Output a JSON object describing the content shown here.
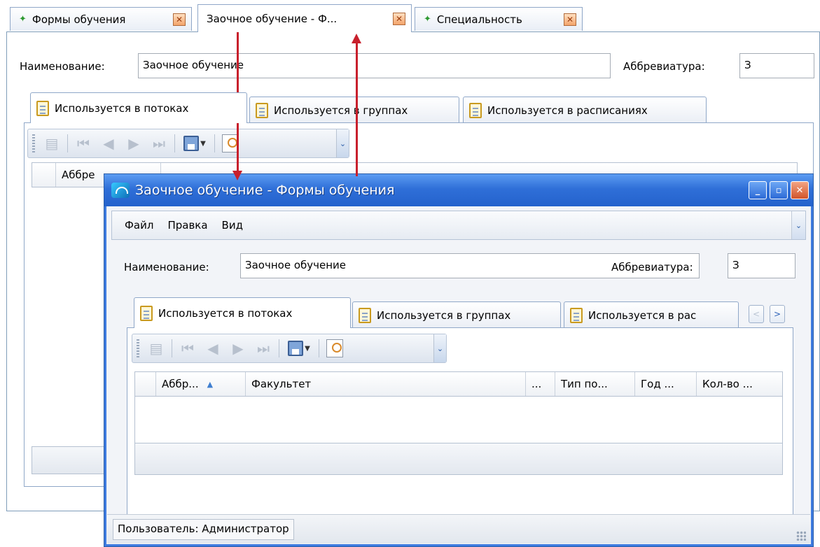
{
  "mdi_tabs": [
    {
      "label": "Формы обучения",
      "icon": "green-star-icon",
      "active": false
    },
    {
      "label": "Заочное обучение - Ф...",
      "icon": "",
      "active": true
    },
    {
      "label": "Специальность",
      "icon": "green-star-icon",
      "active": false
    }
  ],
  "background_form": {
    "name_label": "Наименование:",
    "name_value": "Заочное обучение",
    "abbr_label": "Аббревиатура:",
    "abbr_value": "З",
    "tabs": [
      {
        "label": "Используется в потоках",
        "active": true
      },
      {
        "label": "Используется в группах",
        "active": false
      },
      {
        "label": "Используется в расписаниях",
        "active": false
      }
    ],
    "grid_first_column": "Аббре"
  },
  "popup": {
    "title": "Заочное обучение - Формы обучения",
    "menu": [
      "Файл",
      "Правка",
      "Вид"
    ],
    "name_label": "Наименование:",
    "name_value": "Заочное обучение",
    "abbr_label": "Аббревиатура:",
    "abbr_value": "З",
    "tabs": [
      {
        "label": "Используется в потоках",
        "active": true
      },
      {
        "label": "Используется в группах",
        "active": false
      },
      {
        "label": "Используется в рас",
        "active": false
      }
    ],
    "grid_columns": [
      {
        "label": "Аббр...",
        "sorted": "asc"
      },
      {
        "label": "Факультет"
      },
      {
        "label": "..."
      },
      {
        "label": "Тип по..."
      },
      {
        "label": "Год ..."
      },
      {
        "label": "Кол-во ..."
      }
    ],
    "status_text": "Пользователь: Администратор"
  },
  "colors": {
    "window_title_bar": "#2f6fd8",
    "annotation_arrows": "#c8202c",
    "active_tab_accent": "#8fa7c8"
  }
}
